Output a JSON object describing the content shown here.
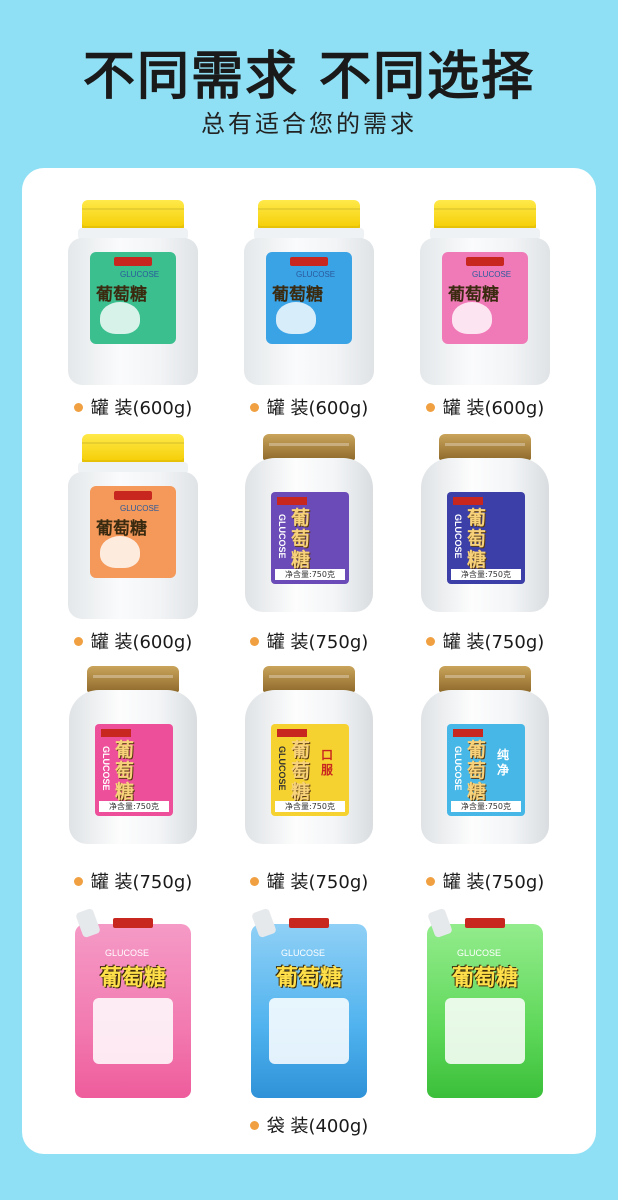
{
  "title": "不同需求 不同选择",
  "subtitle": "总有适合您的需求",
  "products": [
    {
      "style": "jarA",
      "color": "#3bbf8f",
      "cn": "葡萄糖",
      "en": "GLUCOSE",
      "caption": "罐 装(600g)"
    },
    {
      "style": "jarA",
      "color": "#3aa3e6",
      "cn": "葡萄糖",
      "en": "GLUCOSE",
      "caption": "罐 装(600g)"
    },
    {
      "style": "jarA",
      "color": "#f07ab8",
      "cn": "葡萄糖",
      "en": "GLUCOSE",
      "caption": "罐 装(600g)"
    },
    {
      "style": "jarA",
      "color": "#f4995a",
      "cn": "葡萄糖",
      "en": "GLUCOSE",
      "caption": "罐 装(600g)"
    },
    {
      "style": "jarB",
      "color": "#6b4bb7",
      "cn": "葡萄糖",
      "en": "GLUCOSE",
      "side": "",
      "net": "净含量:750克",
      "caption": "罐 装(750g)"
    },
    {
      "style": "jarB",
      "color": "#3c3fa8",
      "cn": "葡萄糖",
      "en": "GLUCOSE",
      "side": "",
      "net": "净含量:750克",
      "caption": "罐 装(750g)"
    },
    {
      "style": "jarB",
      "color": "#ee4f9a",
      "cn": "葡萄糖",
      "en": "GLUCOSE",
      "side": "",
      "net": "净含量:750克",
      "caption": "罐 装(750g)"
    },
    {
      "style": "jarB",
      "color": "#f6d230",
      "cn": "葡萄糖",
      "en": "GLUCOSE",
      "side": "口服",
      "net": "净含量:750克",
      "caption": "罐 装(750g)"
    },
    {
      "style": "jarB",
      "color": "#46b7e6",
      "cn": "葡萄糖",
      "en": "GLUCOSE",
      "side": "纯净",
      "net": "净含量:750克",
      "caption": "罐 装(750g)"
    },
    {
      "style": "pouch",
      "color": "#f27ab0",
      "cn": "葡萄糖",
      "en": "GLUCOSE",
      "caption": ""
    },
    {
      "style": "pouch",
      "color": "#4fb2ee",
      "cn": "葡萄糖",
      "en": "GLUCOSE",
      "caption": "袋 装(400g)"
    },
    {
      "style": "pouch",
      "color": "#5fd85a",
      "cn": "葡萄糖",
      "en": "GLUCOSE",
      "caption": ""
    }
  ]
}
